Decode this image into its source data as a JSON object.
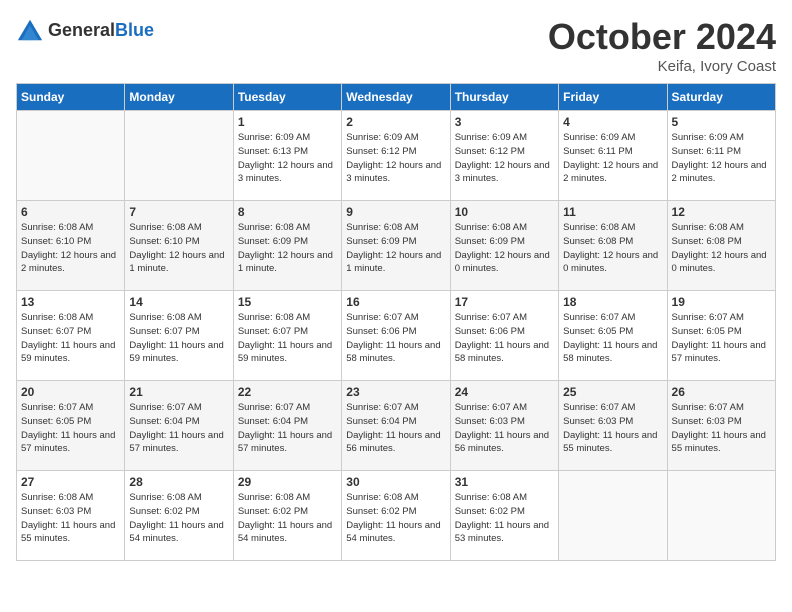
{
  "logo": {
    "general": "General",
    "blue": "Blue"
  },
  "title": "October 2024",
  "location": "Keifa, Ivory Coast",
  "days_of_week": [
    "Sunday",
    "Monday",
    "Tuesday",
    "Wednesday",
    "Thursday",
    "Friday",
    "Saturday"
  ],
  "weeks": [
    [
      {
        "day": "",
        "detail": ""
      },
      {
        "day": "",
        "detail": ""
      },
      {
        "day": "1",
        "detail": "Sunrise: 6:09 AM\nSunset: 6:13 PM\nDaylight: 12 hours\nand 3 minutes."
      },
      {
        "day": "2",
        "detail": "Sunrise: 6:09 AM\nSunset: 6:12 PM\nDaylight: 12 hours\nand 3 minutes."
      },
      {
        "day": "3",
        "detail": "Sunrise: 6:09 AM\nSunset: 6:12 PM\nDaylight: 12 hours\nand 3 minutes."
      },
      {
        "day": "4",
        "detail": "Sunrise: 6:09 AM\nSunset: 6:11 PM\nDaylight: 12 hours\nand 2 minutes."
      },
      {
        "day": "5",
        "detail": "Sunrise: 6:09 AM\nSunset: 6:11 PM\nDaylight: 12 hours\nand 2 minutes."
      }
    ],
    [
      {
        "day": "6",
        "detail": "Sunrise: 6:08 AM\nSunset: 6:10 PM\nDaylight: 12 hours\nand 2 minutes."
      },
      {
        "day": "7",
        "detail": "Sunrise: 6:08 AM\nSunset: 6:10 PM\nDaylight: 12 hours\nand 1 minute."
      },
      {
        "day": "8",
        "detail": "Sunrise: 6:08 AM\nSunset: 6:09 PM\nDaylight: 12 hours\nand 1 minute."
      },
      {
        "day": "9",
        "detail": "Sunrise: 6:08 AM\nSunset: 6:09 PM\nDaylight: 12 hours\nand 1 minute."
      },
      {
        "day": "10",
        "detail": "Sunrise: 6:08 AM\nSunset: 6:09 PM\nDaylight: 12 hours\nand 0 minutes."
      },
      {
        "day": "11",
        "detail": "Sunrise: 6:08 AM\nSunset: 6:08 PM\nDaylight: 12 hours\nand 0 minutes."
      },
      {
        "day": "12",
        "detail": "Sunrise: 6:08 AM\nSunset: 6:08 PM\nDaylight: 12 hours\nand 0 minutes."
      }
    ],
    [
      {
        "day": "13",
        "detail": "Sunrise: 6:08 AM\nSunset: 6:07 PM\nDaylight: 11 hours\nand 59 minutes."
      },
      {
        "day": "14",
        "detail": "Sunrise: 6:08 AM\nSunset: 6:07 PM\nDaylight: 11 hours\nand 59 minutes."
      },
      {
        "day": "15",
        "detail": "Sunrise: 6:08 AM\nSunset: 6:07 PM\nDaylight: 11 hours\nand 59 minutes."
      },
      {
        "day": "16",
        "detail": "Sunrise: 6:07 AM\nSunset: 6:06 PM\nDaylight: 11 hours\nand 58 minutes."
      },
      {
        "day": "17",
        "detail": "Sunrise: 6:07 AM\nSunset: 6:06 PM\nDaylight: 11 hours\nand 58 minutes."
      },
      {
        "day": "18",
        "detail": "Sunrise: 6:07 AM\nSunset: 6:05 PM\nDaylight: 11 hours\nand 58 minutes."
      },
      {
        "day": "19",
        "detail": "Sunrise: 6:07 AM\nSunset: 6:05 PM\nDaylight: 11 hours\nand 57 minutes."
      }
    ],
    [
      {
        "day": "20",
        "detail": "Sunrise: 6:07 AM\nSunset: 6:05 PM\nDaylight: 11 hours\nand 57 minutes."
      },
      {
        "day": "21",
        "detail": "Sunrise: 6:07 AM\nSunset: 6:04 PM\nDaylight: 11 hours\nand 57 minutes."
      },
      {
        "day": "22",
        "detail": "Sunrise: 6:07 AM\nSunset: 6:04 PM\nDaylight: 11 hours\nand 57 minutes."
      },
      {
        "day": "23",
        "detail": "Sunrise: 6:07 AM\nSunset: 6:04 PM\nDaylight: 11 hours\nand 56 minutes."
      },
      {
        "day": "24",
        "detail": "Sunrise: 6:07 AM\nSunset: 6:03 PM\nDaylight: 11 hours\nand 56 minutes."
      },
      {
        "day": "25",
        "detail": "Sunrise: 6:07 AM\nSunset: 6:03 PM\nDaylight: 11 hours\nand 55 minutes."
      },
      {
        "day": "26",
        "detail": "Sunrise: 6:07 AM\nSunset: 6:03 PM\nDaylight: 11 hours\nand 55 minutes."
      }
    ],
    [
      {
        "day": "27",
        "detail": "Sunrise: 6:08 AM\nSunset: 6:03 PM\nDaylight: 11 hours\nand 55 minutes."
      },
      {
        "day": "28",
        "detail": "Sunrise: 6:08 AM\nSunset: 6:02 PM\nDaylight: 11 hours\nand 54 minutes."
      },
      {
        "day": "29",
        "detail": "Sunrise: 6:08 AM\nSunset: 6:02 PM\nDaylight: 11 hours\nand 54 minutes."
      },
      {
        "day": "30",
        "detail": "Sunrise: 6:08 AM\nSunset: 6:02 PM\nDaylight: 11 hours\nand 54 minutes."
      },
      {
        "day": "31",
        "detail": "Sunrise: 6:08 AM\nSunset: 6:02 PM\nDaylight: 11 hours\nand 53 minutes."
      },
      {
        "day": "",
        "detail": ""
      },
      {
        "day": "",
        "detail": ""
      }
    ]
  ]
}
